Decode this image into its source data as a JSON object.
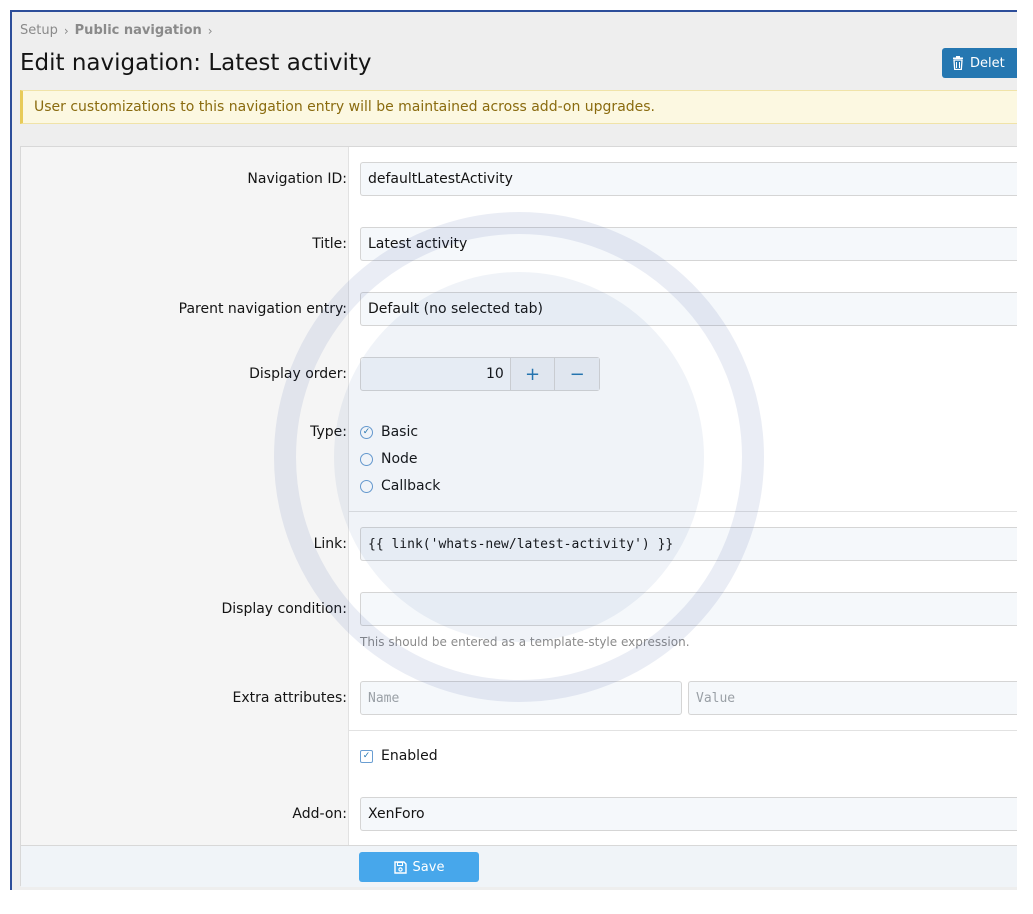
{
  "breadcrumb": {
    "root": "Setup",
    "current": "Public navigation"
  },
  "page": {
    "title": "Edit navigation: Latest activity",
    "delete_label": "Delet"
  },
  "notice": "User customizations to this navigation entry will be maintained across add-on upgrades.",
  "form": {
    "navigation_id": {
      "label": "Navigation ID:",
      "value": "defaultLatestActivity"
    },
    "title": {
      "label": "Title:",
      "value": "Latest activity"
    },
    "parent": {
      "label": "Parent navigation entry:",
      "value": "Default (no selected tab)"
    },
    "display_order": {
      "label": "Display order:",
      "value": "10",
      "plus": "+",
      "minus": "−"
    },
    "type": {
      "label": "Type:",
      "options": [
        "Basic",
        "Node",
        "Callback"
      ],
      "selected": "Basic"
    },
    "link": {
      "label": "Link:",
      "value": "{{ link('whats-new/latest-activity') }}"
    },
    "display_condition": {
      "label": "Display condition:",
      "value": "",
      "hint": "This should be entered as a template-style expression."
    },
    "extra_attributes": {
      "label": "Extra attributes:",
      "name_placeholder": "Name",
      "value_placeholder": "Value"
    },
    "enabled": {
      "label": "Enabled",
      "checked": true
    },
    "addon": {
      "label": "Add-on:",
      "value": "XenForo"
    }
  },
  "footer": {
    "save_label": "Save"
  },
  "colors": {
    "primary": "#2577b1",
    "save": "#47a7eb",
    "notice_bg": "#fcf8e1",
    "notice_text": "#8a6b0f"
  }
}
